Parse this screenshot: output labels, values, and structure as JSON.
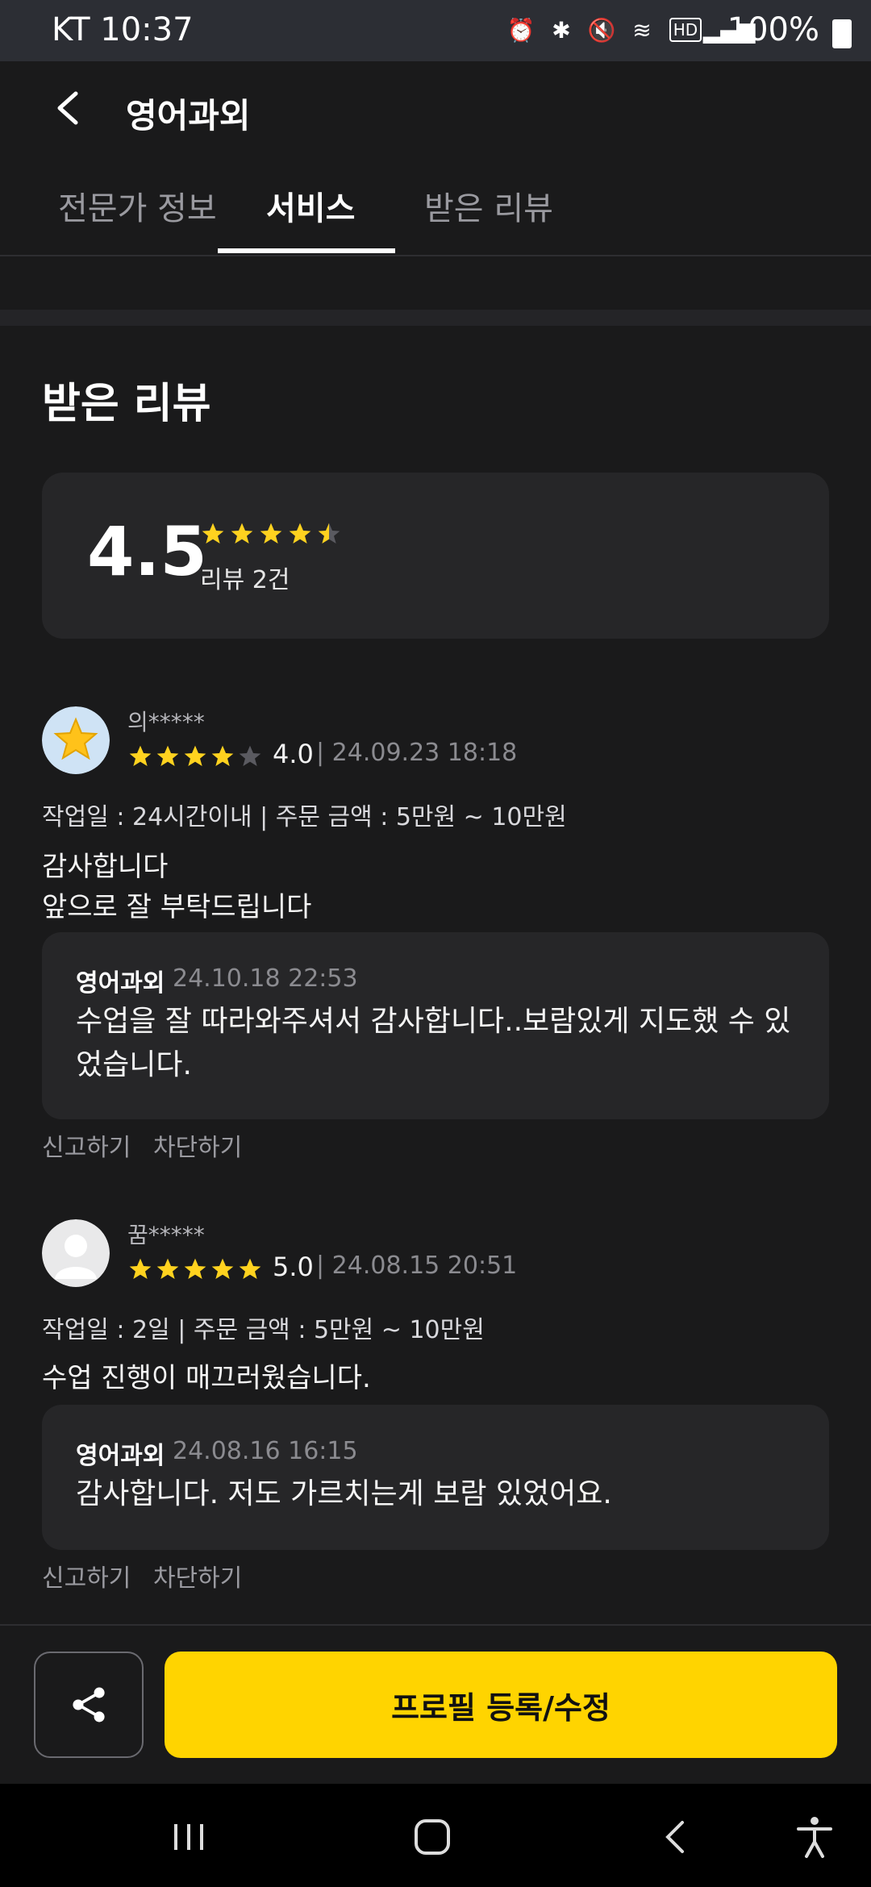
{
  "status_bar": {
    "carrier_time": "KT 10:37",
    "battery": "100%"
  },
  "header": {
    "title": "영어과외"
  },
  "tabs": [
    {
      "label": "전문가 정보"
    },
    {
      "label": "서비스"
    },
    {
      "label": "받은 리뷰"
    }
  ],
  "active_tab": "서비스",
  "section_title": "받은 리뷰",
  "summary": {
    "rating": "4.5",
    "rating_value": 4.5,
    "count_label": "리뷰 2건"
  },
  "reviews": [
    {
      "name": "의*****",
      "score": "4.0",
      "stars": 4,
      "date": "24.09.23 18:18",
      "meta": "작업일 : 24시간이내 | 주문 금액 : 5만원 ~ 10만원",
      "text": "감사합니다\n앞으로 잘 부탁드립니다",
      "avatar_icon": "star-icon",
      "reply": {
        "author": "영어과외",
        "date": "24.10.18 22:53",
        "text": "수업을 잘 따라와주셔서 감사합니다..보람있게 지도했 수 있었습니다."
      },
      "actions": [
        "신고하기",
        "차단하기"
      ]
    },
    {
      "name": "꿈*****",
      "score": "5.0",
      "stars": 5,
      "date": "24.08.15 20:51",
      "meta": "작업일 : 2일 | 주문 금액 : 5만원 ~ 10만원",
      "text": "수업 진행이 매끄러웠습니다.",
      "avatar_icon": "default-user-icon",
      "reply": {
        "author": "영어과외",
        "date": "24.08.16 16:15",
        "text": "감사합니다. 저도 가르치는게 보람 있었어요."
      },
      "actions": [
        "신고하기",
        "차단하기"
      ]
    }
  ],
  "bottom_bar": {
    "primary_label": "프로필 등록/수정",
    "share_icon": "share-icon"
  },
  "colors": {
    "accent": "#ffd400",
    "star": "#ffd21f",
    "star_empty": "#5a5a60",
    "background": "#1a1a1b",
    "card": "#262628"
  }
}
